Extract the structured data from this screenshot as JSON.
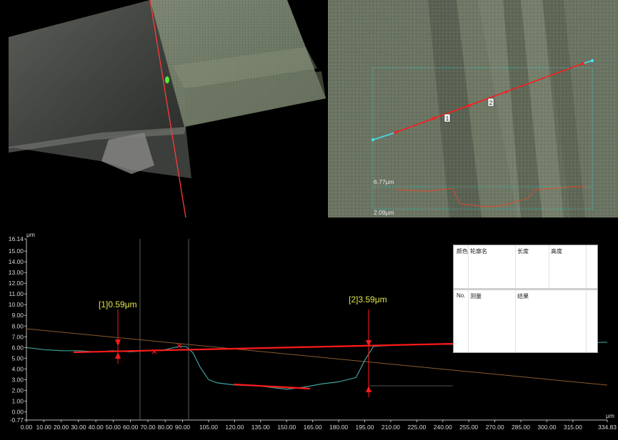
{
  "view3d": {},
  "topview": {
    "marker1": "1",
    "marker2": "2",
    "height_top": "6.77μm",
    "height_bottom": "2.09μm"
  },
  "profile": {
    "y_unit": "μm",
    "x_unit": "μm",
    "measurement1": "[1]0.59μm",
    "measurement2": "[2]3.59μm",
    "y_ticks": [
      "16.14",
      "15.00",
      "14.00",
      "13.00",
      "12.00",
      "11.00",
      "10.00",
      "9.00",
      "8.00",
      "7.00",
      "6.00",
      "5.00",
      "4.00",
      "3.00",
      "2.00",
      "1.00",
      "0.00",
      "-0.77"
    ],
    "x_ticks": [
      "0.00",
      "10.00",
      "20.00",
      "30.00",
      "40.00",
      "50.00",
      "60.00",
      "70.00",
      "80.00",
      "90.00",
      "105.00",
      "120.00",
      "135.00",
      "150.00",
      "165.00",
      "180.00",
      "195.00",
      "210.00",
      "225.00",
      "240.00",
      "255.00",
      "270.00",
      "285.00",
      "300.00",
      "315.00",
      "334.83"
    ]
  },
  "profile_table": {
    "col_color": "颜色",
    "col_name": "轮廓名",
    "col_length": "长度",
    "col_height": "高度"
  },
  "measure_table": {
    "col_no": "No.",
    "col_measure": "测量",
    "col_result": "结果"
  },
  "colors": {
    "measure_red": "#ff1a1a",
    "profile_teal": "#3fa19a",
    "label_yellow": "#e4e84a",
    "cyan": "#3fe4f2"
  },
  "chart_data": {
    "type": "line",
    "xlabel": "μm",
    "ylabel": "μm",
    "xlim": [
      0,
      334.83
    ],
    "ylim": [
      -0.77,
      16.14
    ],
    "series": [
      {
        "x": [
          0,
          10,
          20,
          30,
          40,
          50,
          60,
          70,
          80,
          88,
          92,
          96,
          100,
          105,
          110,
          120,
          135,
          150,
          160,
          170,
          180,
          190,
          195,
          200,
          210,
          225,
          240,
          255,
          270,
          285,
          300,
          315,
          334.83
        ],
        "y": [
          6.0,
          5.8,
          5.7,
          5.7,
          5.6,
          5.7,
          5.6,
          5.7,
          5.8,
          6.1,
          6.1,
          5.5,
          4.2,
          3.0,
          2.7,
          2.5,
          2.4,
          2.1,
          2.3,
          2.6,
          2.8,
          3.2,
          4.8,
          6.1,
          6.2,
          6.3,
          6.3,
          6.3,
          6.3,
          6.3,
          6.3,
          6.4,
          6.5
        ]
      }
    ],
    "annotations": [
      {
        "label": "[1]0.59μm",
        "x": 52,
        "y_top": 6.15,
        "y_bottom": 5.56
      },
      {
        "label": "[2]3.59μm",
        "x": 198,
        "y_top": 6.09,
        "y_bottom": 2.5
      }
    ]
  }
}
